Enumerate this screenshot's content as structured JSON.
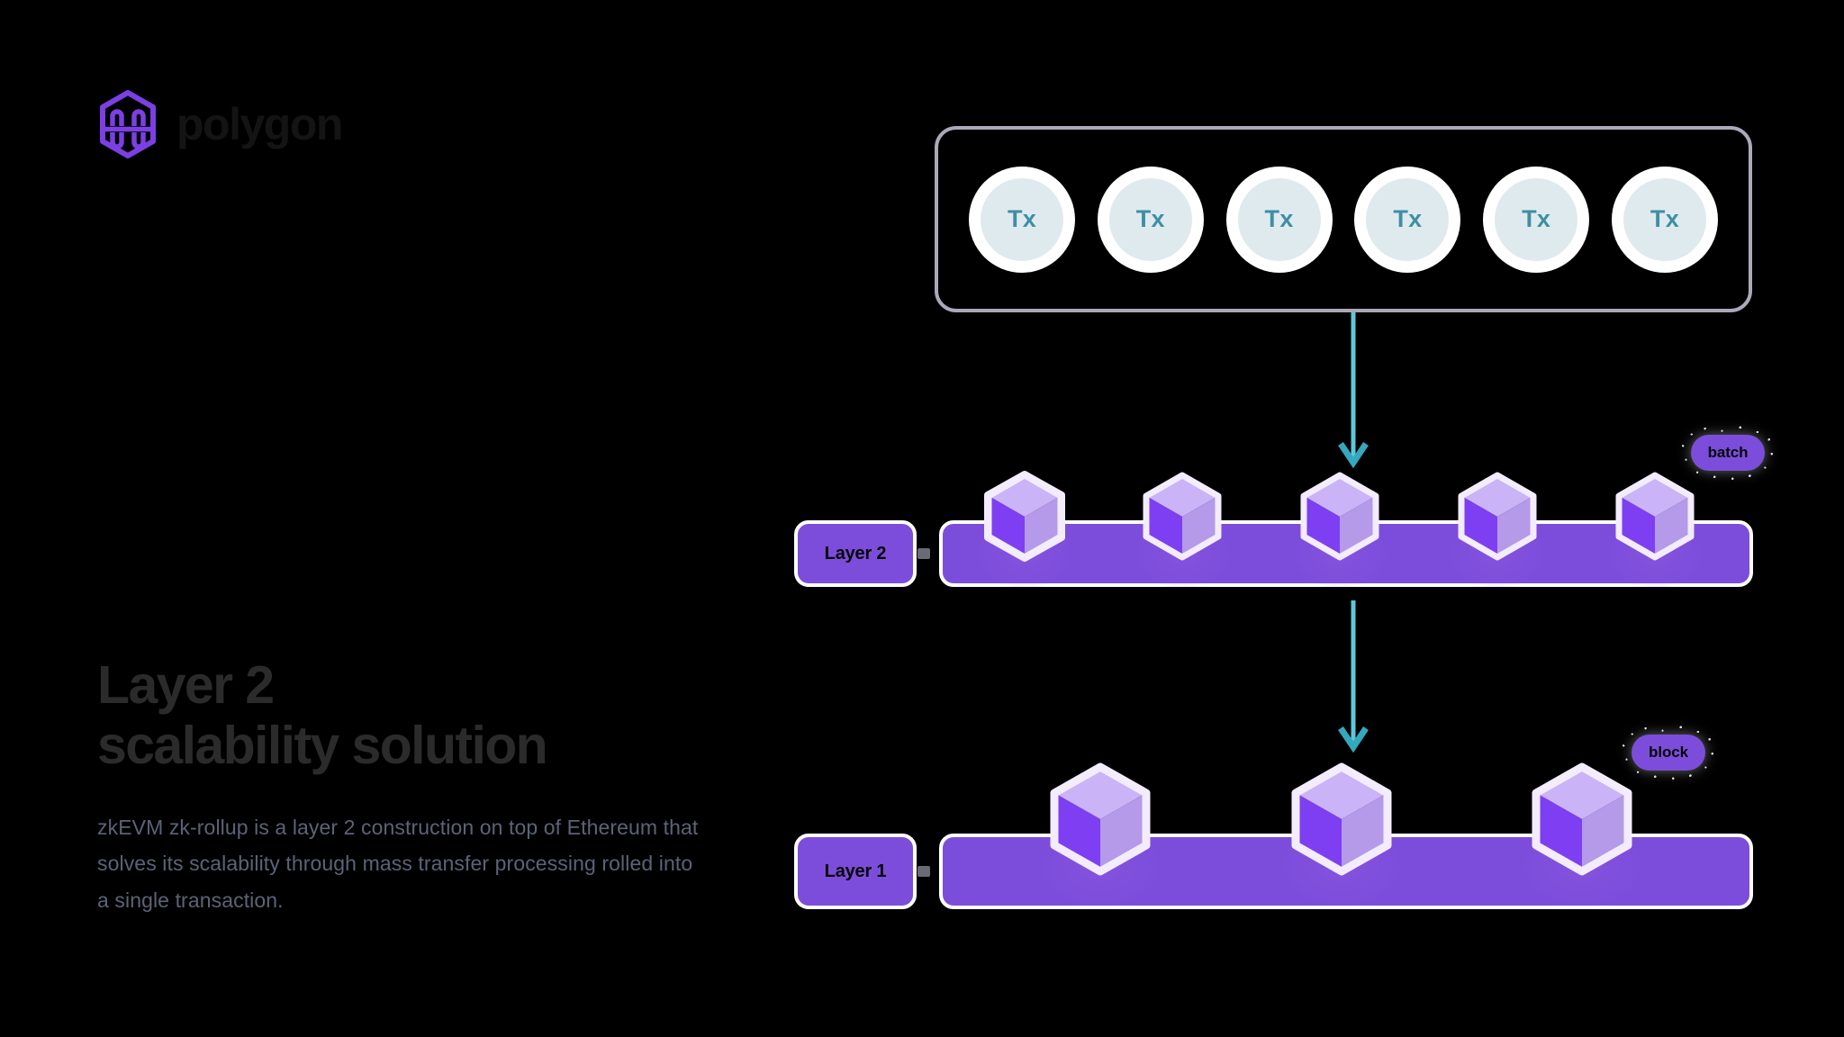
{
  "brand": {
    "logo_icon": "polygon-hexagon-logo",
    "wordmark": "polygon",
    "purple": "#7b3fe4",
    "wordmark_color": "#141414"
  },
  "copy": {
    "headline_line1": "Layer 2",
    "headline_line2": "scalability solution",
    "body": "zkEVM zk-rollup is a layer 2 construction on top of Ethereum that solves its scalability through mass transfer processing rolled into a single transaction.",
    "headline_color": "#2b2b2b",
    "body_color": "#5c6377"
  },
  "diagram": {
    "tx_pool": {
      "border_color": "#a9a9b9",
      "node_label": "Tx",
      "node_count": 6,
      "nodes": [
        {
          "label": "Tx"
        },
        {
          "label": "Tx"
        },
        {
          "label": "Tx"
        },
        {
          "label": "Tx"
        },
        {
          "label": "Tx"
        },
        {
          "label": "Tx"
        }
      ],
      "node_ring_color": "#ffffff",
      "node_fill_color": "#dfeaef",
      "node_text_color": "#3e8fa3"
    },
    "arrows": {
      "color": "#5ec8d8",
      "arrow_1_name": "tx-to-layer2-arrow",
      "arrow_2_name": "layer2-to-layer1-arrow"
    },
    "layer2": {
      "badge_label": "Layer 2",
      "bar_color": "#7c4ddb",
      "bar_border_color": "#ffffff",
      "cube_count": 5,
      "tag_label": "batch"
    },
    "layer1": {
      "badge_label": "Layer 1",
      "bar_color": "#7c4ddb",
      "bar_border_color": "#ffffff",
      "cube_count": 3,
      "tag_label": "block"
    },
    "cube_colors": {
      "top_face": "#cbb3f7",
      "left_face": "#7e3ff2",
      "right_face": "#b49ae9",
      "outline": "#f3ecfd"
    }
  }
}
